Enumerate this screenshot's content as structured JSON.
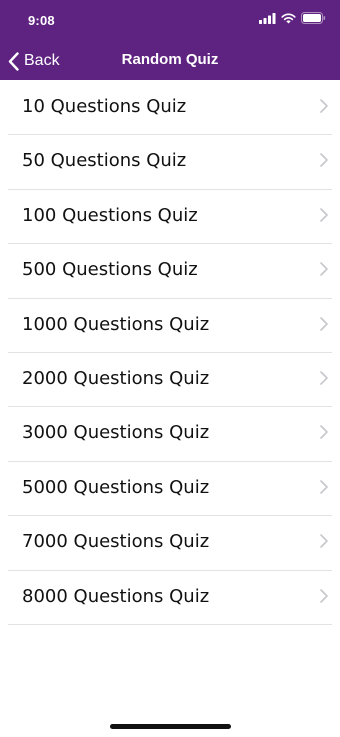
{
  "status_bar": {
    "time": "9:08"
  },
  "nav": {
    "back_label": "Back",
    "title": "Random Quiz"
  },
  "colors": {
    "header": "#5e2380",
    "chevron": "#c7c7cc"
  },
  "list": {
    "items": [
      "10 Questions Quiz",
      "50 Questions Quiz",
      "100 Questions Quiz",
      "500 Questions Quiz",
      "1000 Questions Quiz",
      "2000 Questions Quiz",
      "3000 Questions Quiz",
      "5000 Questions Quiz",
      "7000 Questions Quiz",
      "8000 Questions Quiz"
    ]
  }
}
